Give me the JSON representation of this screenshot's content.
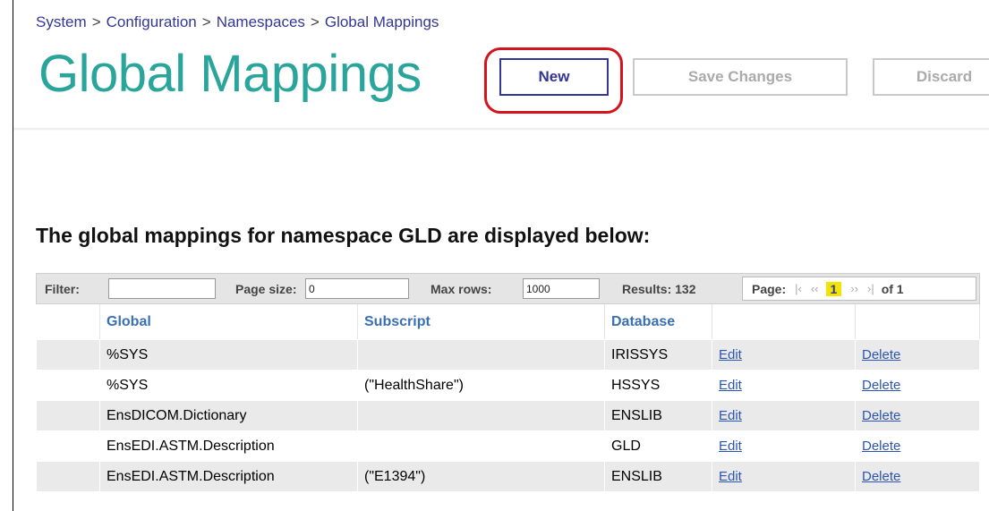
{
  "breadcrumb": {
    "items": [
      "System",
      "Configuration",
      "Namespaces",
      "Global Mappings"
    ],
    "separator": ">"
  },
  "page": {
    "title": "Global Mappings",
    "heading": "The global mappings for namespace GLD are displayed below:"
  },
  "toolbar": {
    "new_label": "New",
    "save_label": "Save Changes",
    "discard_label": "Discard"
  },
  "filterbar": {
    "filter_label": "Filter:",
    "filter_value": "",
    "page_size_label": "Page size:",
    "page_size_value": "0",
    "max_rows_label": "Max rows:",
    "max_rows_value": "1000",
    "results_text": "Results: 132",
    "page_label": "Page:",
    "current_page": "1",
    "of_text": "of 1",
    "nav_first": "|‹",
    "nav_prev": "‹‹",
    "nav_next": "››",
    "nav_last": "›|"
  },
  "table": {
    "headers": [
      "",
      "Global",
      "Subscript",
      "Database",
      "",
      ""
    ],
    "edit_label": "Edit",
    "delete_label": "Delete",
    "rows": [
      {
        "global": "%SYS",
        "subscript": "",
        "database": "IRISSYS"
      },
      {
        "global": "%SYS",
        "subscript": "(\"HealthShare\")",
        "database": "HSSYS"
      },
      {
        "global": "EnsDICOM.Dictionary",
        "subscript": "",
        "database": "ENSLIB"
      },
      {
        "global": "EnsEDI.ASTM.Description",
        "subscript": "",
        "database": "GLD"
      },
      {
        "global": "EnsEDI.ASTM.Description",
        "subscript": "(\"E1394\")",
        "database": "ENSLIB"
      }
    ]
  },
  "colors": {
    "title": "#2aa59b",
    "breadcrumb": "#333695",
    "highlight": "#d4131e",
    "header_text": "#3a6fb3",
    "link": "#2a55b3",
    "current_page_bg": "#f2e400"
  }
}
